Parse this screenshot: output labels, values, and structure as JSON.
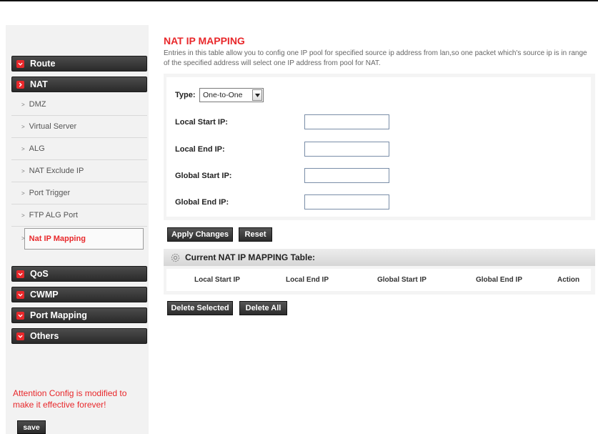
{
  "sidebar": {
    "menus": [
      {
        "id": "route",
        "label": "Route"
      },
      {
        "id": "nat",
        "label": "NAT"
      },
      {
        "id": "qos",
        "label": "QoS"
      },
      {
        "id": "cwmp",
        "label": "CWMP"
      },
      {
        "id": "port-mapping",
        "label": "Port Mapping"
      },
      {
        "id": "others",
        "label": "Others"
      }
    ],
    "nat_items": [
      {
        "label": "DMZ"
      },
      {
        "label": "Virtual Server"
      },
      {
        "label": "ALG"
      },
      {
        "label": "NAT Exclude IP"
      },
      {
        "label": "Port Trigger"
      },
      {
        "label": "FTP ALG Port"
      },
      {
        "label": "Nat IP Mapping",
        "active": true
      }
    ],
    "attention_text": "Attention Config is modified to make it effective forever!",
    "save_label": "save"
  },
  "main": {
    "title": "NAT IP MAPPING",
    "description": "Entries in this table allow you to config one IP pool for specified source ip address from lan,so one packet which's source ip is in range of the specified address will select one IP address from pool for NAT.",
    "form": {
      "type_label": "Type:",
      "type_value": "One-to-One",
      "fields": [
        {
          "label": "Local Start IP:",
          "value": ""
        },
        {
          "label": "Local End IP:",
          "value": ""
        },
        {
          "label": "Global Start IP:",
          "value": ""
        },
        {
          "label": "Global End IP:",
          "value": ""
        }
      ],
      "apply_label": "Apply Changes",
      "reset_label": "Reset"
    },
    "table": {
      "title": "Current NAT IP MAPPING Table:",
      "columns": [
        "Local Start IP",
        "Local End IP",
        "Global Start IP",
        "Global End IP",
        "Action"
      ],
      "delete_selected_label": "Delete Selected",
      "delete_all_label": "Delete All"
    }
  },
  "colors": {
    "accent": "#e8282b",
    "menu_bg": "#2a2a2a",
    "sidebar_bg": "#f2f2f2"
  },
  "icons": {
    "menu_chevron": "chevron-down-icon",
    "menu_chevron_open": "chevron-right-icon",
    "sub_arrow": "arrow-right-icon",
    "table_header": "gear-icon",
    "select_dropdown": "dropdown-arrow-icon"
  }
}
